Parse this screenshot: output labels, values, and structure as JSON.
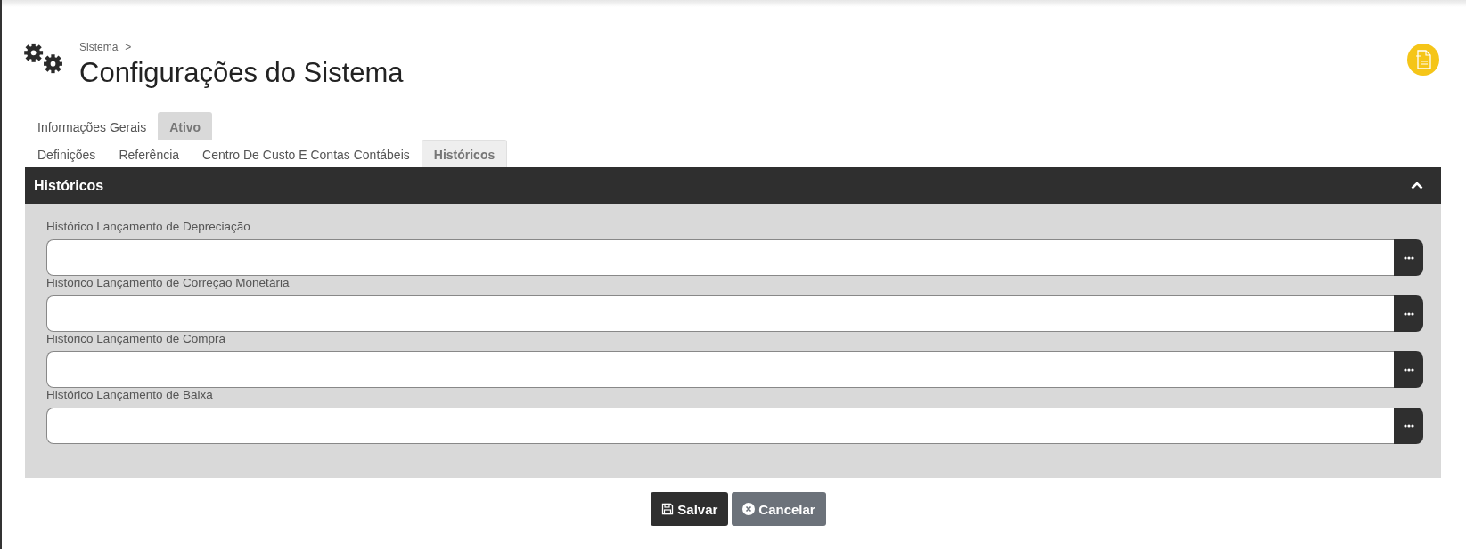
{
  "breadcrumb": {
    "items": [
      "Sistema"
    ],
    "separator": ">"
  },
  "title": "Configurações do Sistema",
  "tabs": [
    {
      "label": "Informações Gerais",
      "selected": false
    },
    {
      "label": "Ativo",
      "selected": true
    }
  ],
  "subtabs": [
    {
      "label": "Definições",
      "selected": false
    },
    {
      "label": "Referência",
      "selected": false
    },
    {
      "label": "Centro De Custo E Contas Contábeis",
      "selected": false
    },
    {
      "label": "Históricos",
      "selected": true
    }
  ],
  "panel": {
    "title": "Históricos",
    "expanded": true,
    "fields": [
      {
        "label": "Histórico Lançamento de Depreciação"
      },
      {
        "label": "Histórico Lançamento de Correção Monetária"
      },
      {
        "label": "Histórico Lançamento de Compra"
      },
      {
        "label": "Histórico Lançamento de Baixa"
      }
    ]
  },
  "buttons": [
    {
      "label": "Salvar",
      "kind": "primary"
    },
    {
      "label": "Cancelar",
      "kind": "secondary"
    }
  ]
}
